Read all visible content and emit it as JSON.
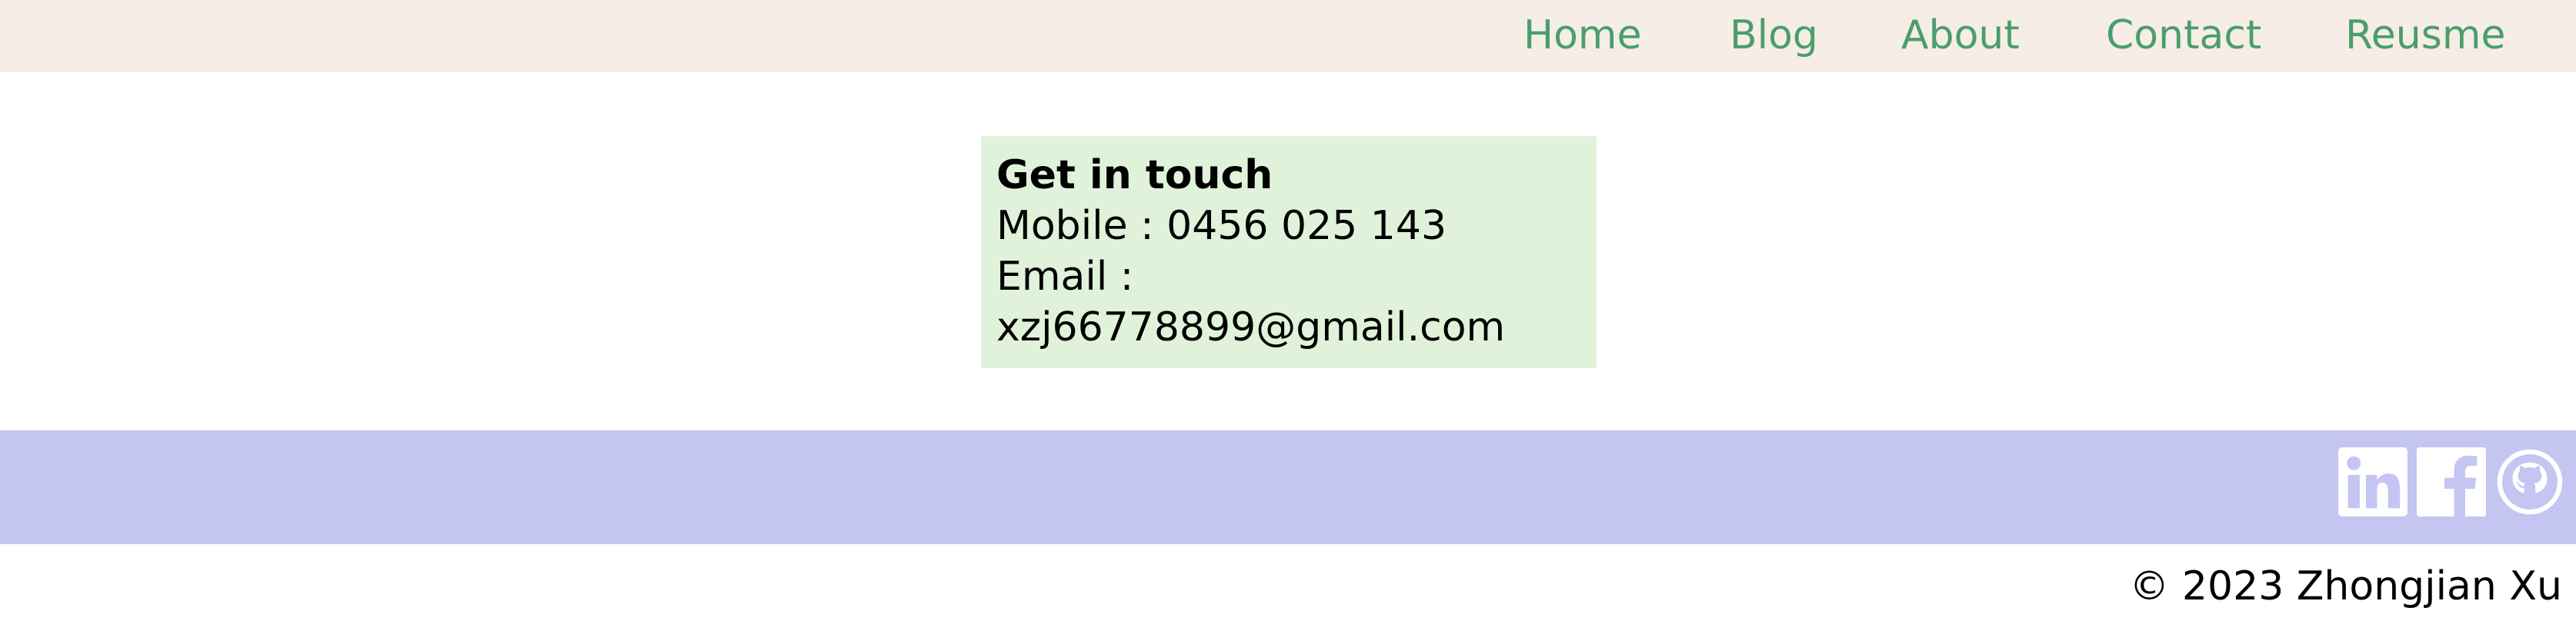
{
  "nav": {
    "items": [
      {
        "label": "Home"
      },
      {
        "label": "Blog"
      },
      {
        "label": "About"
      },
      {
        "label": "Contact"
      },
      {
        "label": "Reusme"
      }
    ]
  },
  "contact": {
    "title": "Get in touch",
    "mobile": "Mobile : 0456 025 143",
    "email_label": "Email :",
    "email_value": "xzj66778899@gmail.com"
  },
  "social": {
    "icons": [
      "linkedin-icon",
      "facebook-icon",
      "github-icon"
    ]
  },
  "footer": {
    "copyright": "© 2023 Zhongjian Xu"
  },
  "colors": {
    "nav_bg": "#f5ede6",
    "nav_link": "#4a9e6b",
    "card_bg": "#e0f3da",
    "social_bg": "#c5c5f2",
    "icon": "#ffffff"
  }
}
